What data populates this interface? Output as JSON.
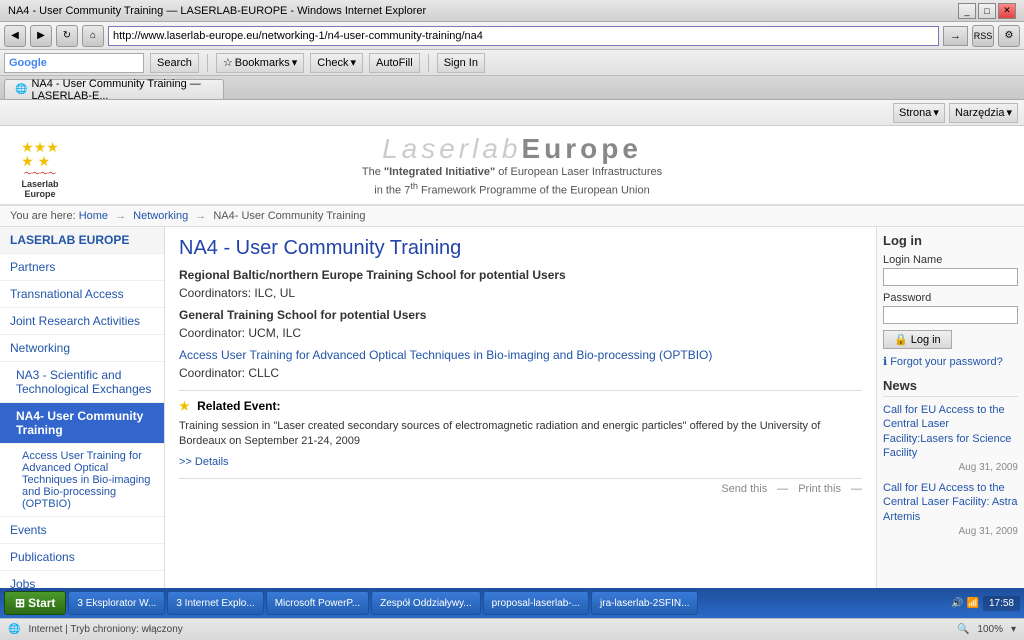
{
  "window": {
    "title": "NA4 - User Community Training — LASERLAB-EUROPE - Windows Internet Explorer"
  },
  "address_bar": {
    "url": "http://www.laserlab-europe.eu/networking-1/n4-user-community-training/na4"
  },
  "toolbar": {
    "search_label": "Search",
    "bookmarks_label": "Bookmarks",
    "check_label": "Check",
    "autofill_label": "AutoFill",
    "sign_in_label": "Sign In",
    "google_label": "Google"
  },
  "tab": {
    "label": "NA4 - User Community Training — LASERLAB-E..."
  },
  "ie_toolbar": {
    "strona_label": "Strona",
    "narzedzia_label": "Narzędzia"
  },
  "breadcrumb": {
    "home": "Home",
    "networking": "Networking",
    "current": "NA4- User Community Training"
  },
  "header": {
    "site_title_light": "Laserlab",
    "site_title_bold": "Europe",
    "logo_name": "Laserlab\nEurope",
    "subtitle_bold": "\"Integrated Initiative\"",
    "subtitle_text1": "The",
    "subtitle_text2": "of European Laser Infrastructures",
    "subtitle_text3": "in the 7",
    "subtitle_sup": "th",
    "subtitle_text4": "Framework Programme of the European Union"
  },
  "sidebar": {
    "items": [
      {
        "label": "LASERLAB EUROPE",
        "type": "section"
      },
      {
        "label": "Partners",
        "type": "item"
      },
      {
        "label": "Transnational Access",
        "type": "item"
      },
      {
        "label": "Joint Research Activities",
        "type": "item"
      },
      {
        "label": "Networking",
        "type": "item"
      },
      {
        "label": "NA3 - Scientific and Technological Exchanges",
        "type": "sub-item"
      },
      {
        "label": "NA4- User Community Training",
        "type": "sub-item",
        "active": true
      },
      {
        "label": "Access User Training for Advanced Optical Techniques in Bio-imaging and Bio-processing (OPTBIO)",
        "type": "sub-sub-item"
      },
      {
        "label": "Events",
        "type": "item"
      },
      {
        "label": "Publications",
        "type": "item"
      },
      {
        "label": "Jobs",
        "type": "item"
      }
    ]
  },
  "main": {
    "page_title": "NA4 - User Community Training",
    "line1": "Regional Baltic/northern Europe Training School for potential Users",
    "line2": "Coordinators: ILC, UL",
    "line3": "General Training School for potential Users",
    "line4": "Coordinator: UCM, ILC",
    "link_text": "Access User Training for Advanced Optical Techniques in Bio-imaging and Bio-processing (OPTBIO)",
    "line5": "Coordinator: CLLC",
    "related_label": "Related Event:",
    "training_text": "Training session in \"Laser created secondary sources of electromagnetic radiation and energic particles\" offered by the University of Bordeaux on September 21-24, 2009",
    "details_link": ">> Details",
    "send_label": "Send this",
    "print_label": "Print this"
  },
  "right_panel": {
    "login_title": "Log in",
    "login_name_label": "Login Name",
    "password_label": "Password",
    "login_btn": "Log in",
    "forgot_label": "Forgot your password?",
    "news_title": "News",
    "news_items": [
      {
        "link": "Call for EU Access to the Central Laser Facility:Lasers for Science Facility",
        "date": "Aug 31, 2009"
      },
      {
        "link": "Call for EU Access to the Central Laser Facility: Astra Artemis",
        "date": "Aug 31, 2009"
      }
    ]
  },
  "status_bar": {
    "text": "Internet | Tryb chroniony: włączony",
    "zoom": "100%"
  },
  "taskbar": {
    "time": "17:58",
    "buttons": [
      "3 Eksplorator W...",
      "3 Internet Explo...",
      "Microsoft PowerP...",
      "Zespół Oddziaływy...",
      "proposal-laserlab-...",
      "jra-laserlab-2SFIN..."
    ]
  }
}
